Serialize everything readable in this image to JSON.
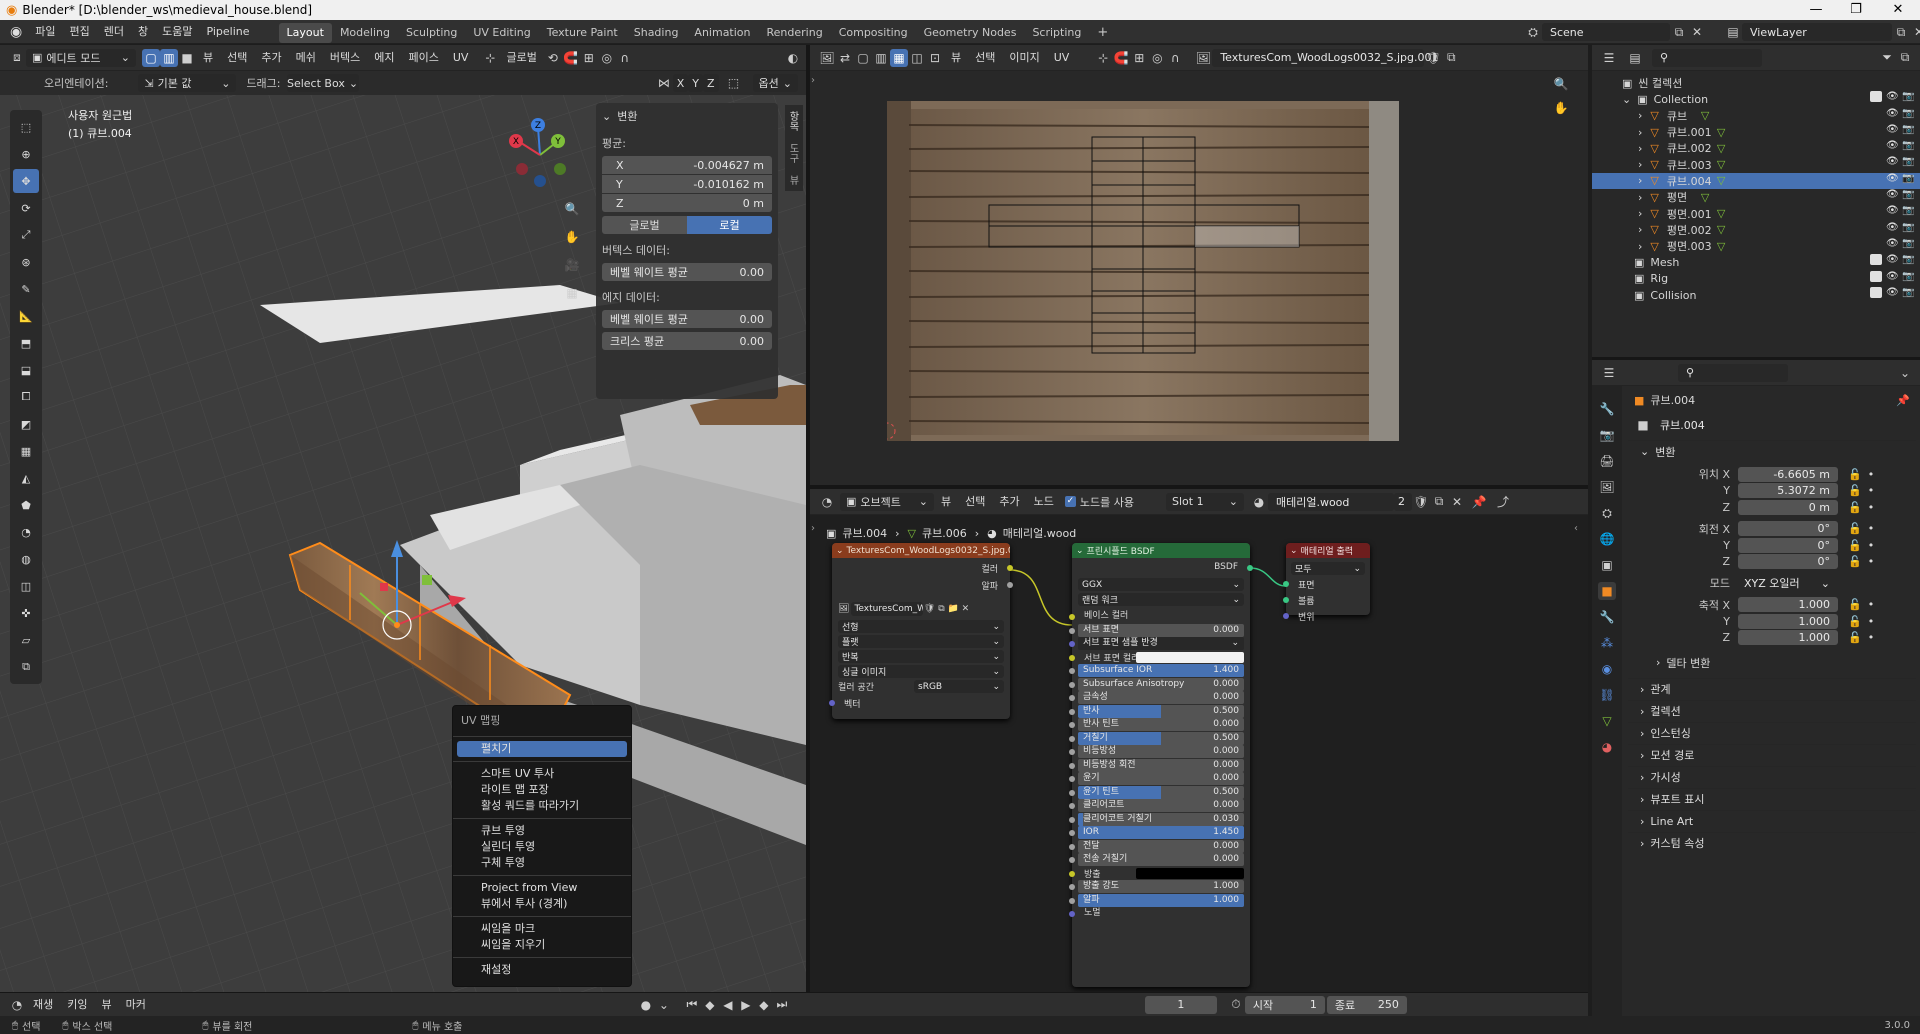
{
  "window": {
    "title": "Blender* [D:\\blender_ws\\medieval_house.blend]",
    "min": "—",
    "max": "❐",
    "close": "✕"
  },
  "menus": [
    "파일",
    "편집",
    "렌더",
    "창",
    "도움말",
    "Pipeline"
  ],
  "workspaces": [
    {
      "label": "Layout",
      "active": true
    },
    {
      "label": "Modeling"
    },
    {
      "label": "Sculpting"
    },
    {
      "label": "UV Editing"
    },
    {
      "label": "Texture Paint"
    },
    {
      "label": "Shading"
    },
    {
      "label": "Animation"
    },
    {
      "label": "Rendering"
    },
    {
      "label": "Compositing"
    },
    {
      "label": "Geometry Nodes"
    },
    {
      "label": "Scripting"
    }
  ],
  "add_workspace": "+",
  "scene": "Scene",
  "view_layer": "ViewLayer",
  "viewport": {
    "mode": "에디트 모드",
    "menus": [
      "뷰",
      "선택",
      "추가",
      "메쉬",
      "버텍스",
      "에지",
      "페이스",
      "UV"
    ],
    "transform_orientation": "글로벌",
    "orientation_label": "오리엔테이션:",
    "orientation_value": "기본 값",
    "drag_label": "드래그:",
    "drag_value": "Select Box",
    "xyz": [
      "X",
      "Y",
      "Z"
    ],
    "options": "옵션",
    "view_name": "사용자 원근법",
    "object_name": "(1) 큐브.004",
    "gizmo_axes": [
      "Z",
      "Y",
      "X"
    ]
  },
  "transform_panel": {
    "title": "변환",
    "median": "평균:",
    "x_label": "X",
    "x_value": "-0.004627 m",
    "y_label": "Y",
    "y_value": "-0.010162 m",
    "z_label": "Z",
    "z_value": "0 m",
    "global": "글로벌",
    "local": "로컬",
    "vertex_data": "버텍스 데이터:",
    "vertex_bevel": "베벨 웨이트 평균",
    "vertex_bevel_value": "0.00",
    "edge_data": "에지 데이터:",
    "edge_bevel": "베벨 웨이트 평균",
    "edge_bevel_value": "0.00",
    "crease": "크리스 평균",
    "crease_value": "0.00"
  },
  "side_tabs": [
    "항목",
    "도구",
    "뷰"
  ],
  "uv_menu": {
    "title": "UV 맵핑",
    "groups": [
      [
        "펼치기",
        "스마트 UV 투사",
        "라이트 맵 포장",
        "활성 쿼드를 따라가기"
      ],
      [
        "큐브 투영",
        "실린더 투영",
        "구체 투영"
      ],
      [
        "Project from View",
        "뷰에서 투사 (경계)"
      ],
      [
        "씨임을 마크",
        "씨임을 지우기"
      ],
      [
        "재설정"
      ]
    ],
    "highlighted": "펼치기"
  },
  "image_editor": {
    "menus": [
      "뷰",
      "선택",
      "이미지",
      "UV"
    ],
    "image_name": "TexturesCom_WoodLogs0032_S.jpg.001"
  },
  "shader_editor": {
    "object_mode": "오브젝트",
    "menus": [
      "뷰",
      "선택",
      "추가",
      "노드"
    ],
    "use_nodes": "노드를 사용",
    "slot": "Slot 1",
    "material": "매테리얼.wood",
    "users": "2",
    "breadcrumbs": [
      "큐브.004",
      "큐브.006",
      "매테리얼.wood"
    ],
    "tex_node": {
      "title": "TexturesCom_WoodLogs0032_S.jpg.00",
      "out_color": "컬러",
      "out_alpha": "알파",
      "img": "TexturesCom_W...",
      "interp": "선형",
      "proj": "플랫",
      "ext": "반복",
      "src": "싱글 이미지",
      "cs_label": "컬러 공간",
      "cs_value": "sRGB",
      "vector": "벡터"
    },
    "bsdf_node": {
      "title": "프린시플드 BSDF",
      "out": "BSDF",
      "dist": "GGX",
      "sss_method": "랜덤 워크",
      "rows": [
        {
          "label": "베이스 컬러",
          "type": "label"
        },
        {
          "label": "서브 표면",
          "value": "0.000"
        },
        {
          "label": "서브 표면 샘플 반경",
          "type": "dropdown"
        },
        {
          "label": "서브 표면 컬러",
          "type": "color",
          "color": "#f2f2f2"
        },
        {
          "label": "Subsurface IOR",
          "value": "1.400",
          "fill": 100
        },
        {
          "label": "Subsurface Anisotropy",
          "value": "0.000"
        },
        {
          "label": "금속성",
          "value": "0.000"
        },
        {
          "label": "반사",
          "value": "0.500",
          "fill": 50
        },
        {
          "label": "반사 틴트",
          "value": "0.000"
        },
        {
          "label": "거칠기",
          "value": "0.500",
          "fill": 50
        },
        {
          "label": "비등방성",
          "value": "0.000"
        },
        {
          "label": "비등방성 회전",
          "value": "0.000"
        },
        {
          "label": "윤기",
          "value": "0.000"
        },
        {
          "label": "윤기 틴트",
          "value": "0.500",
          "fill": 50
        },
        {
          "label": "클리어코트",
          "value": "0.000"
        },
        {
          "label": "클리어코트 거칠기",
          "value": "0.030",
          "fill": 3
        },
        {
          "label": "IOR",
          "value": "1.450",
          "fill": 100
        },
        {
          "label": "전달",
          "value": "0.000"
        },
        {
          "label": "전송 거칠기",
          "value": "0.000"
        },
        {
          "label": "방출",
          "type": "color",
          "color": "#000000"
        },
        {
          "label": "방출 강도",
          "value": "1.000"
        },
        {
          "label": "알파",
          "value": "1.000",
          "fill": 100
        },
        {
          "label": "노멀",
          "type": "label"
        }
      ]
    },
    "output_node": {
      "title": "매테리얼 출력",
      "target": "모두",
      "inputs": [
        "표면",
        "볼륨",
        "변위"
      ]
    }
  },
  "timeline": {
    "menus": [
      "재생",
      "키잉",
      "뷰",
      "마커"
    ],
    "frame": "1",
    "start_label": "시작",
    "start": "1",
    "end_label": "종료",
    "end": "250"
  },
  "status": {
    "items": [
      "선택",
      "박스 선택",
      "뷰를 회전",
      "메뉴 호출"
    ],
    "version": "3.0.0"
  },
  "outliner": {
    "root": "씬 컬렉션",
    "collection": "Collection",
    "objects": [
      {
        "name": "큐브",
        "sel": false
      },
      {
        "name": "큐브.001",
        "sel": false
      },
      {
        "name": "큐브.002",
        "sel": false
      },
      {
        "name": "큐브.003",
        "sel": false
      },
      {
        "name": "큐브.004",
        "sel": true
      },
      {
        "name": "평면",
        "sel": false
      },
      {
        "name": "평면.001",
        "sel": false
      },
      {
        "name": "평면.002",
        "sel": false
      },
      {
        "name": "평면.003",
        "sel": false
      }
    ],
    "collections": [
      "Mesh",
      "Rig",
      "Collision"
    ]
  },
  "properties": {
    "object_name": "큐브.004",
    "object_field": "큐브.004",
    "transform_title": "변환",
    "location_label": "위치 X",
    "loc_x": "-6.6605 m",
    "loc_y": "5.3072 m",
    "loc_z": "0 m",
    "rotation_label": "회전 X",
    "rot_x": "0°",
    "rot_y": "0°",
    "rot_z": "0°",
    "mode_label": "모드",
    "mode": "XYZ 오일러",
    "scale_label": "축적 X",
    "scale_x": "1.000",
    "scale_y": "1.000",
    "scale_z": "1.000",
    "axis_y": "Y",
    "axis_z": "Z",
    "delta": "델타 변환",
    "sections": [
      "관계",
      "컬렉션",
      "인스턴싱",
      "모션 경로",
      "가시성",
      "뷰포트 표시",
      "Line Art",
      "커스텀 속성"
    ]
  }
}
